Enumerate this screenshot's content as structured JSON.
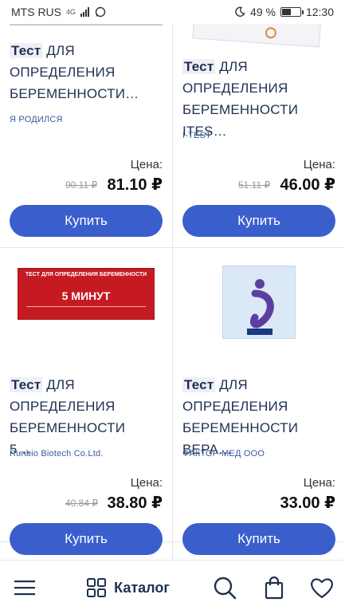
{
  "status_bar": {
    "carrier": "MTS RUS",
    "signal_text": "4G",
    "battery": "49 %",
    "battery_level": 0.49,
    "time": "12:30"
  },
  "products": [
    {
      "title_highlight": "Тест",
      "title_rest": " ДЛЯ ОПРЕДЕЛЕНИЯ БЕРЕМЕННОСТИ…",
      "brand": "Я РОДИЛСЯ",
      "price_label": "Цена:",
      "old_price": "90.11 ₽",
      "price": "81.10 ₽",
      "buy_label": "Купить"
    },
    {
      "title_highlight": "Тест",
      "title_rest": " ДЛЯ ОПРЕДЕЛЕНИЯ БЕРЕМЕННОСТИ ITES…",
      "brand": "I-TEST",
      "price_label": "Цена:",
      "old_price": "51.11 ₽",
      "price": "46.00 ₽",
      "buy_label": "Купить"
    },
    {
      "title_highlight": "Тест",
      "title_rest": " ДЛЯ ОПРЕДЕЛЕНИЯ БЕРЕМЕННОСТИ 5…",
      "brand": "Runbio Biotech Co.Ltd.",
      "price_label": "Цена:",
      "old_price": "40.84 ₽",
      "price": "38.80 ₽",
      "buy_label": "Купить",
      "image_text_1": "ТЕСТ ДЛЯ ОПРЕДЕЛЕНИЯ БЕРЕМЕННОСТИ",
      "image_text_2": "5 МИНУТ"
    },
    {
      "title_highlight": "Тест",
      "title_rest": " ДЛЯ ОПРЕДЕЛЕНИЯ БЕРЕМЕННОСТИ ВЕРА…",
      "brand": "ФАКТОР-МЕД ООО",
      "price_label": "Цена:",
      "old_price": "",
      "price": "33.00 ₽",
      "buy_label": "Купить"
    }
  ],
  "bottom_nav": {
    "catalog_label": "Каталог",
    "icons": [
      "menu-icon",
      "catalog-grid-icon",
      "search-icon",
      "cart-bag-icon",
      "favorites-heart-icon"
    ]
  },
  "colors": {
    "accent": "#3a5fcd",
    "title": "#1e3050",
    "brand": "#3a5a9a"
  }
}
